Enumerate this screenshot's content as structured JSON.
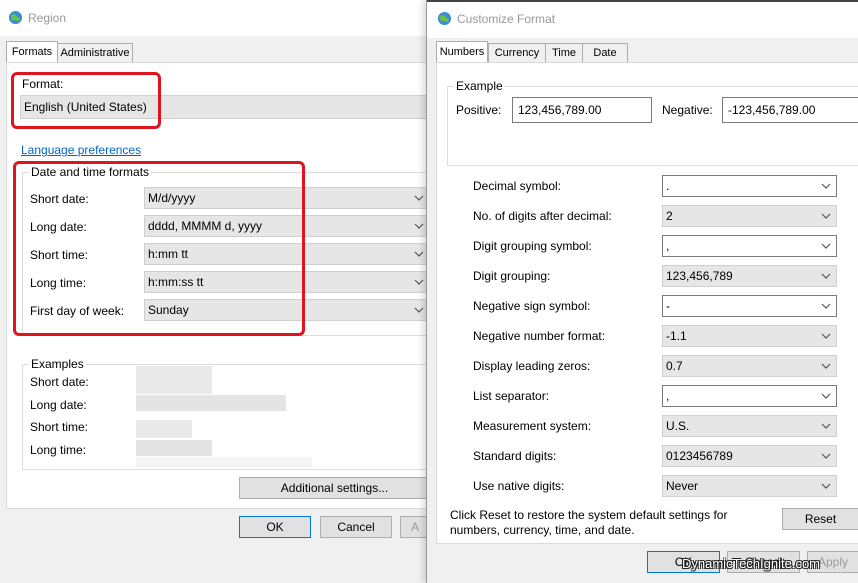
{
  "region": {
    "title": "Region",
    "tabs": [
      "Formats",
      "Administrative"
    ],
    "format_label": "Format:",
    "format_value": "English (United States)",
    "language_link": "Language preferences",
    "datetime_group": "Date and time formats",
    "rows": [
      {
        "label": "Short date:",
        "value": "M/d/yyyy"
      },
      {
        "label": "Long date:",
        "value": "dddd, MMMM d, yyyy"
      },
      {
        "label": "Short time:",
        "value": "h:mm tt"
      },
      {
        "label": "Long time:",
        "value": "h:mm:ss tt"
      },
      {
        "label": "First day of week:",
        "value": "Sunday"
      }
    ],
    "examples_group": "Examples",
    "examples": [
      "Short date:",
      "Long date:",
      "Short time:",
      "Long time:"
    ],
    "additional_settings": "Additional settings...",
    "ok": "OK",
    "cancel": "Cancel",
    "apply": "A"
  },
  "customize": {
    "title": "Customize Format",
    "tabs": [
      "Numbers",
      "Currency",
      "Time",
      "Date"
    ],
    "example_group": "Example",
    "positive_label": "Positive:",
    "positive_value": "123,456,789.00",
    "negative_label": "Negative:",
    "negative_value": "-123,456,789.00",
    "settings": [
      {
        "label": "Decimal symbol:",
        "value": "."
      },
      {
        "label": "No. of digits after decimal:",
        "value": "2"
      },
      {
        "label": "Digit grouping symbol:",
        "value": ","
      },
      {
        "label": "Digit grouping:",
        "value": "123,456,789"
      },
      {
        "label": "Negative sign symbol:",
        "value": "-"
      },
      {
        "label": "Negative number format:",
        "value": "-1.1"
      },
      {
        "label": "Display leading zeros:",
        "value": "0.7"
      },
      {
        "label": "List separator:",
        "value": ","
      },
      {
        "label": "Measurement system:",
        "value": "U.S."
      },
      {
        "label": "Standard digits:",
        "value": "0123456789"
      },
      {
        "label": "Use native digits:",
        "value": "Never"
      }
    ],
    "reset_note_1": "Click Reset to restore the system default settings for",
    "reset_note_2": "numbers, currency, time, and date.",
    "reset": "Reset",
    "ok": "OK",
    "cancel": "Cancel",
    "apply": "Apply"
  },
  "watermark": "DynamicTechIgnite.com",
  "colors": {
    "highlight": "#e0141e",
    "link": "#0066cc"
  }
}
